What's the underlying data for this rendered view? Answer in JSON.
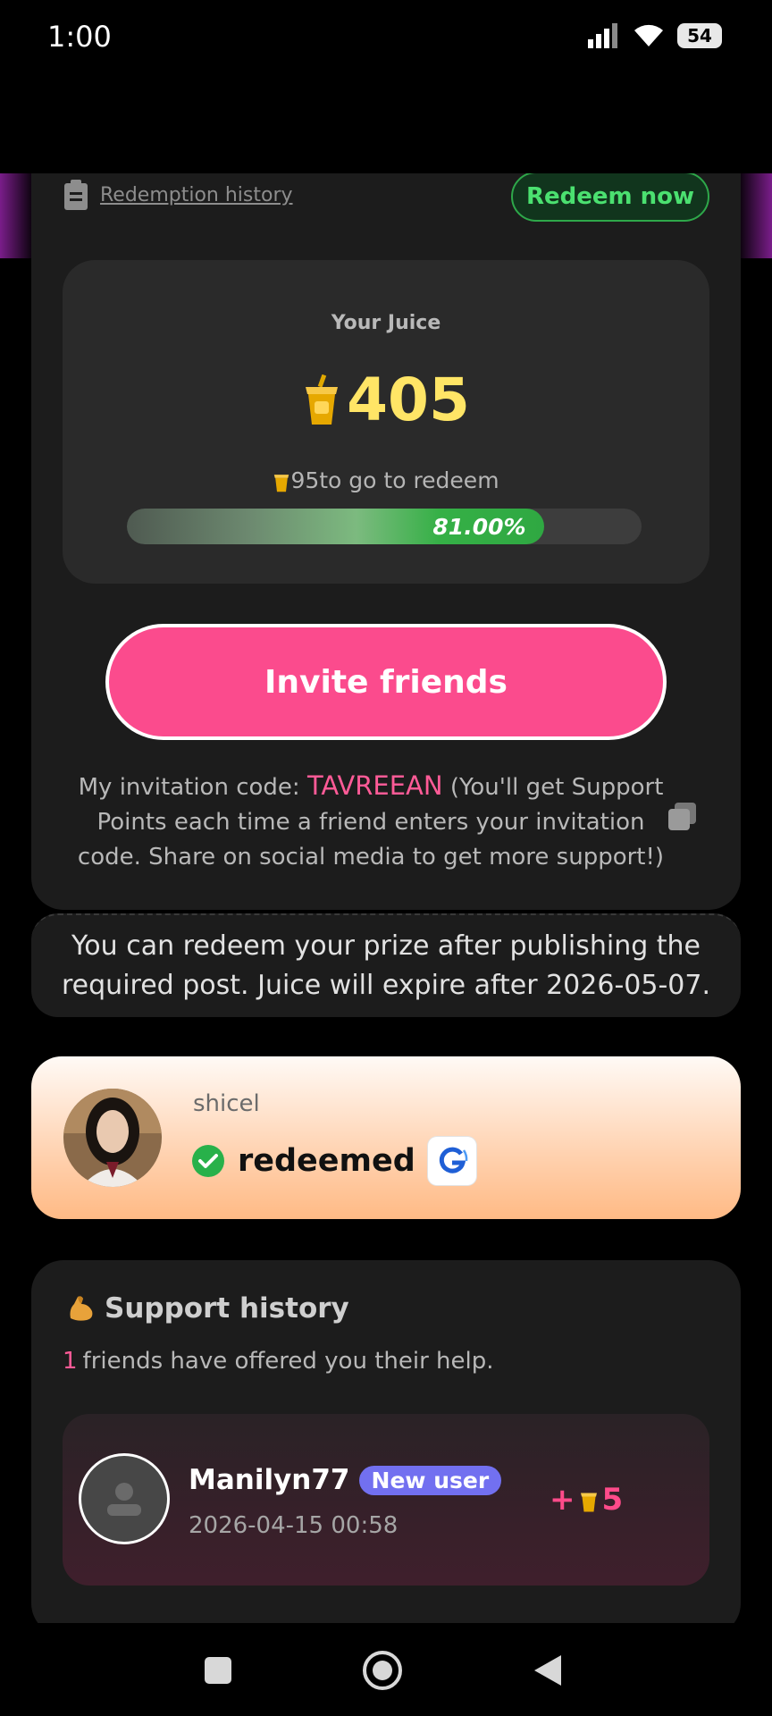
{
  "status_bar": {
    "time": "1:00",
    "battery": "54"
  },
  "header": {
    "history_link": "Redemption history",
    "redeem_button": "Redeem now"
  },
  "juice": {
    "label": "Your Juice",
    "amount": "405",
    "to_go_amount": "95",
    "to_go_text": "to go to redeem",
    "progress_text": "81.00%",
    "progress_value": 0.81
  },
  "invite": {
    "button": "Invite friends",
    "code_prefix": "My invitation code: ",
    "code": "TAVREEAN",
    "description": " (You'll get Support Points each time a friend enters your invitation code. Share on social media to get more support!)"
  },
  "notice": "You can redeem your prize after publishing the required post. Juice will expire after 2026-05-07.",
  "redeemed": {
    "username": "shicel",
    "status": "redeemed"
  },
  "support": {
    "title": "Support history",
    "count": "1",
    "count_text": "friends have offered you their help.",
    "items": [
      {
        "name": "Manilyn77",
        "badge": "New user",
        "date": "2026-04-15 00:58",
        "reward": "5"
      }
    ]
  },
  "colors": {
    "accent_pink": "#fb4b8d",
    "accent_green": "#2fa842",
    "juice_yellow": "#ffe566"
  },
  "icons": [
    "signal-icon",
    "wifi-icon",
    "clipboard-icon",
    "juice-cup-icon",
    "copy-icon",
    "check-circle-icon",
    "g-brand-icon",
    "flexed-biceps-icon",
    "user-placeholder-icon",
    "nav-square-icon",
    "nav-home-icon",
    "nav-back-icon"
  ]
}
